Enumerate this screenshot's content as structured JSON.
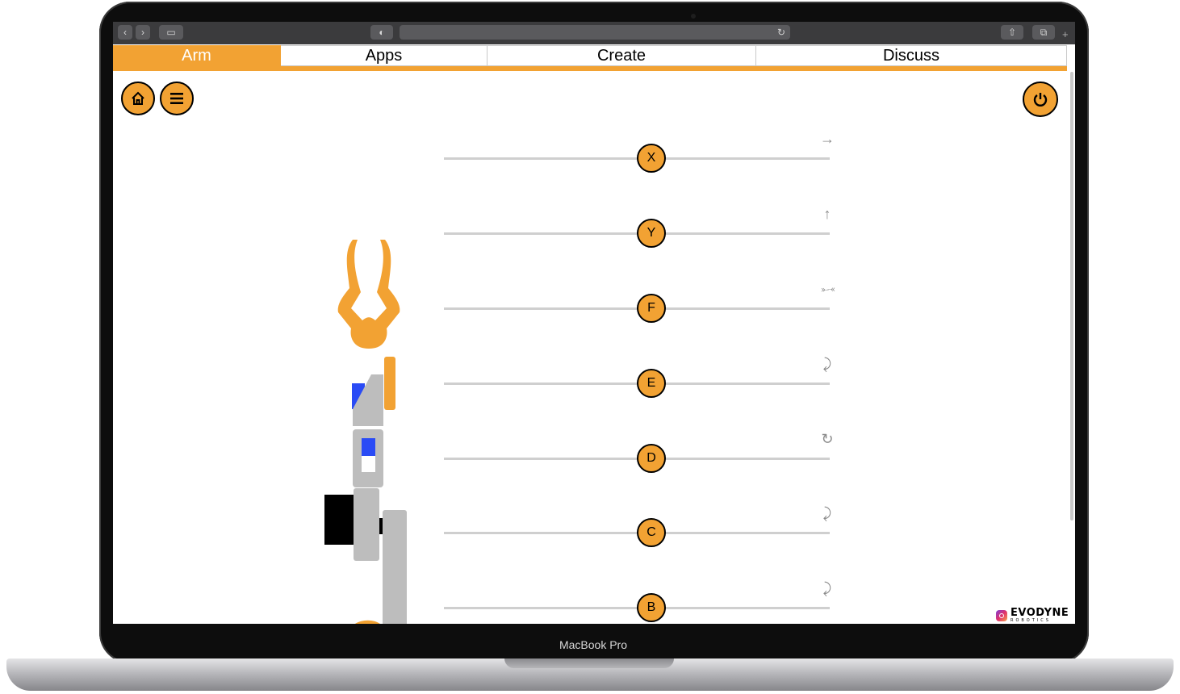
{
  "device": {
    "model_label": "MacBook Pro"
  },
  "browser": {
    "reload_icon": "reload-icon",
    "add_tab": "+"
  },
  "tabs": [
    {
      "label": "Arm",
      "active": true
    },
    {
      "label": "Apps",
      "active": false
    },
    {
      "label": "Create",
      "active": false
    },
    {
      "label": "Discuss",
      "active": false
    }
  ],
  "controls": {
    "home_icon": "home-icon",
    "menu_icon": "hamburger-menu-icon",
    "power_icon": "power-icon"
  },
  "sliders": [
    {
      "label": "X",
      "icon": "arrow-right-icon",
      "glyph": "→",
      "value": 0.5
    },
    {
      "label": "Y",
      "icon": "arrow-up-icon",
      "glyph": "↑",
      "value": 0.5
    },
    {
      "label": "F",
      "icon": "gripper-squeeze-icon",
      "glyph": "⤜⤛",
      "value": 0.5
    },
    {
      "label": "E",
      "icon": "rotate-arc-icon",
      "glyph": "⤸",
      "value": 0.5
    },
    {
      "label": "D",
      "icon": "rotate-circle-icon",
      "glyph": "↻",
      "value": 0.5
    },
    {
      "label": "C",
      "icon": "rotate-arc-icon",
      "glyph": "⤸",
      "value": 0.5
    },
    {
      "label": "B",
      "icon": "rotate-arc-icon",
      "glyph": "⤸",
      "value": 0.5
    }
  ],
  "branding": {
    "name": "EVODYNE",
    "tagline": "ROBOTICS",
    "social_icon": "instagram-icon"
  },
  "colors": {
    "accent": "#f2a233",
    "arm_gray": "#bdbdbd",
    "marker_blue": "#2a4bf5"
  }
}
